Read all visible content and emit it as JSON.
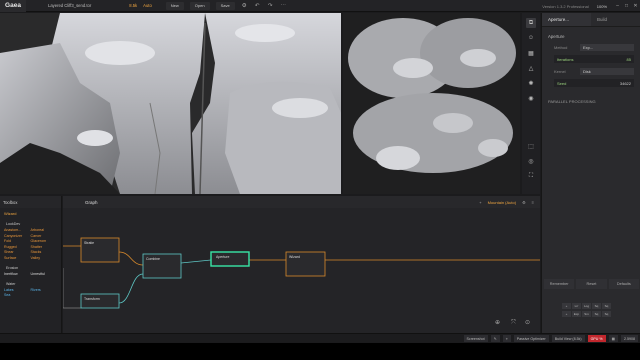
{
  "titlebar": {
    "app": "Gaea",
    "filename": "Layered Cliff3_send.tor",
    "resolution": "8.5k",
    "build_mode": "Auto",
    "new_label": "New",
    "open_label": "Open",
    "save_label": "Save",
    "version": "Version 1.3.2 Professional",
    "zoom": "100%"
  },
  "properties": {
    "tab_active": "Aperture...",
    "tab_build": "Build",
    "section": "Aperture",
    "method_label": "Method",
    "method_value": "Exp...",
    "iterations_label": "Iterations",
    "iterations_value": "85",
    "kernel_label": "Kernel",
    "kernel_value": "Disk",
    "seed_label": "Seed",
    "seed_value": "34622",
    "parallel": "PARALLEL PROCESSING",
    "btn_remember": "Remember",
    "btn_reset": "Reset",
    "btn_defaults": "Defaults",
    "keypad_row1": [
      "+",
      "Lrr",
      "Log",
      "Sq",
      "Sq"
    ],
    "keypad_row2": [
      "+",
      "Exp",
      "Sm",
      "Sq",
      "Sq"
    ]
  },
  "toolbox": {
    "title": "Toolbox",
    "selected": "Wizard",
    "cat1": "LookDev",
    "items1": [
      [
        "Anastom...",
        "Arboreal"
      ],
      [
        "Canyonizer",
        "Carver"
      ],
      [
        "Fold",
        "Glacerom"
      ],
      [
        "Rugged",
        "Shatter"
      ],
      [
        "Shear",
        "Stacks"
      ],
      [
        "Surface",
        "Valley"
      ]
    ],
    "cat2": "Erosion",
    "items2": [
      [
        "Inertflow",
        "Unrestful"
      ]
    ],
    "cat3": "Water",
    "items3": [
      [
        "Lakes",
        "Rivers"
      ],
      [
        "Sea",
        ""
      ]
    ]
  },
  "graph": {
    "tab": "Graph",
    "mode": "Mountain (Auto)",
    "nodes": {
      "n1": "Stratie",
      "n2": "Combine",
      "n3": "Aperture",
      "n4": "Wizard",
      "n5": "Transform"
    }
  },
  "statusbar": {
    "screenshot": "Screenshot",
    "passive": "Passive Optimizer",
    "build": "Build View (8.5k)",
    "gpu": "GPU %",
    "value": "2.5908"
  },
  "colors": {
    "accent": "#f0a640",
    "node_orange": "#d98a2b",
    "node_cyan": "#5ec7c5",
    "node_selected": "#39e6a7",
    "status_red": "#c1272d"
  }
}
